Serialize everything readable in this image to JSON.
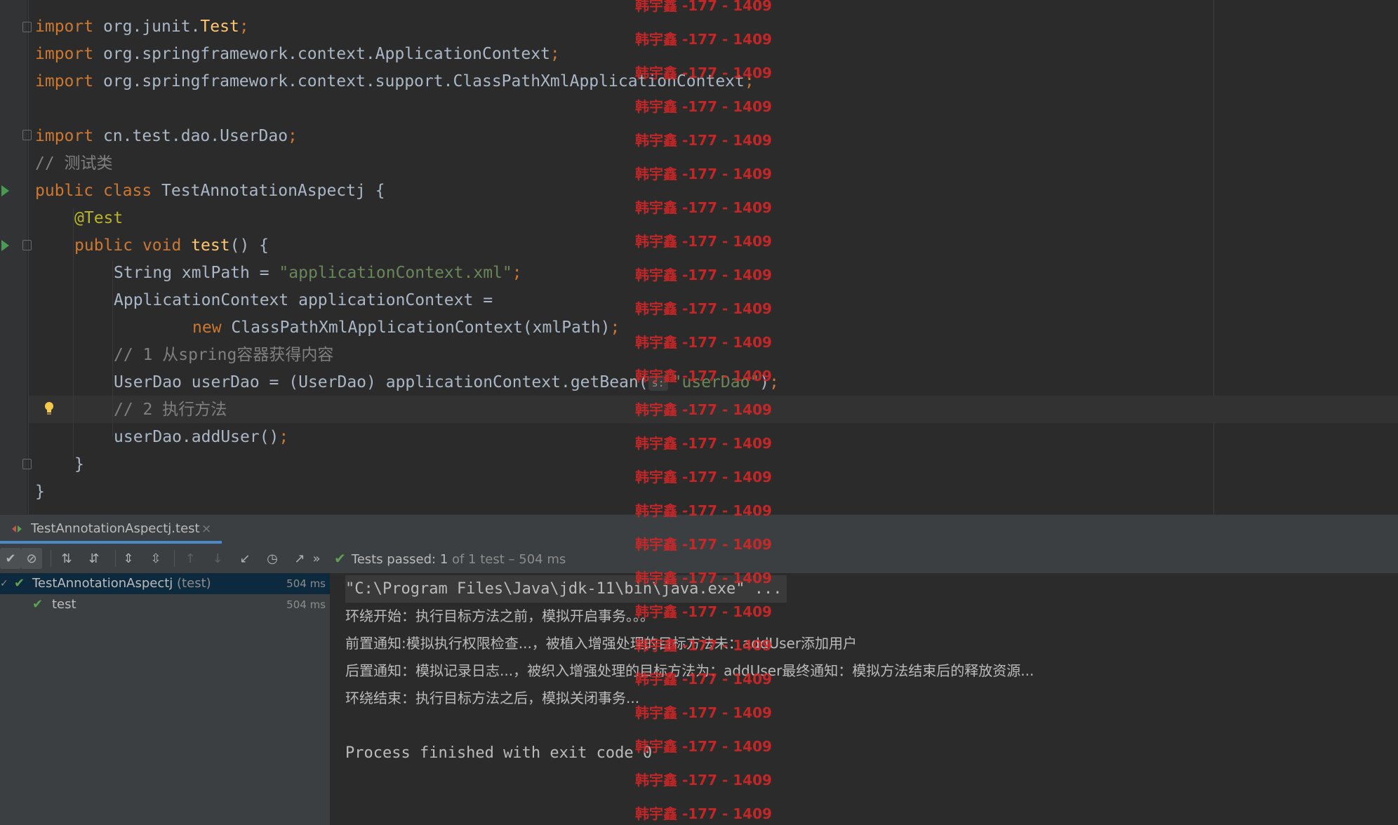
{
  "editor": {
    "lines": [
      {
        "kind": "import",
        "kw": "import",
        "text": " org.junit.",
        "cls": "Test",
        "semi": ";"
      },
      {
        "kind": "plain",
        "kw": "import",
        "text": " org.springframework.context.ApplicationContext",
        "semi": ";"
      },
      {
        "kind": "plain",
        "kw": "import",
        "text": " org.springframework.context.support.ClassPathXmlApplicationContext",
        "semi": ";"
      },
      {
        "kind": "plain",
        "kw": "import",
        "text": " cn.test.dao.UserDao",
        "semi": ";"
      },
      {
        "kind": "comment",
        "text": "// 测试类"
      },
      {
        "kind": "class",
        "kw1": "public",
        "kw2": "class",
        "text": " TestAnnotationAspectj {"
      },
      {
        "kind": "annotation",
        "text": "@Test"
      },
      {
        "kind": "method",
        "kw1": "public",
        "kw2": "void",
        "fn": "test",
        "text": "() {"
      },
      {
        "kind": "str",
        "pre": "String xmlPath = ",
        "str": "\"applicationContext.xml\"",
        "semi": ";"
      },
      {
        "kind": "plain2",
        "text": "ApplicationContext applicationContext ="
      },
      {
        "kind": "new",
        "kw": "new",
        "text": " ClassPathXmlApplicationContext(xmlPath)",
        "semi": ";"
      },
      {
        "kind": "comment",
        "text": "// 1 从spring容器获得内容"
      },
      {
        "kind": "getbean",
        "pre": "UserDao userDao = (UserDao) applicationContext.getBean(",
        "hint": "s:",
        "str": "\"userDao\"",
        "post": ")",
        "semi": ";"
      },
      {
        "kind": "comment",
        "text": "// 2 执行方法"
      },
      {
        "kind": "plain2",
        "text": "userDao.addUser()",
        "semi": ";"
      },
      {
        "kind": "plain2",
        "text": "}"
      },
      {
        "kind": "plain2",
        "text": "}"
      }
    ]
  },
  "run_tab": {
    "label": "TestAnnotationAspectj.test",
    "close": "×"
  },
  "toolbar": {
    "status_check": "✔",
    "status_prefix": "Tests passed: ",
    "status_count": "1",
    "status_suffix": " of 1 test – 504 ms",
    "more": "»"
  },
  "tree": [
    {
      "label": "TestAnnotationAspectj",
      "sub": " (test)",
      "duration": "504 ms",
      "selected": true
    },
    {
      "label": "test",
      "sub": "",
      "duration": "504 ms",
      "selected": false
    }
  ],
  "console": {
    "command": "\"C:\\Program Files\\Java\\jdk-11\\bin\\java.exe\" ...",
    "lines": [
      "环绕开始：执行目标方法之前，模拟开启事务。。。",
      "前置通知:模拟执行权限检查...，被植入增强处理的目标方法未：addUser添加用户",
      "后置通知：模拟记录日志...，被织入增强处理的目标方法为：addUser最终通知：模拟方法结束后的释放资源...",
      "环绕结束：执行目标方法之后，模拟关闭事务...",
      "",
      "Process finished with exit code 0"
    ]
  },
  "watermark": {
    "text": "韩宇鑫 -177 - 1409"
  }
}
